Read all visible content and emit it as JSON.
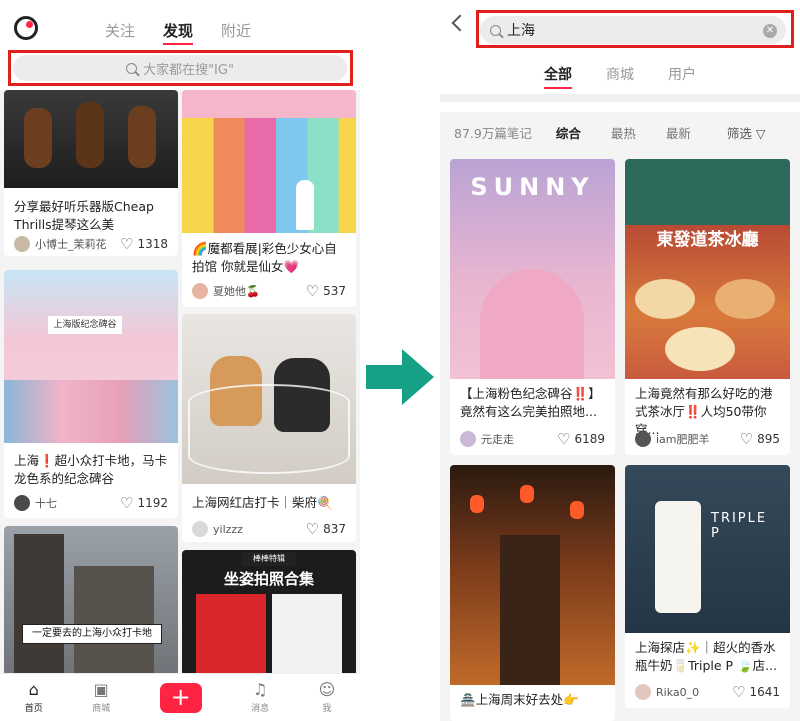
{
  "left": {
    "tabs": [
      "关注",
      "发现",
      "附近"
    ],
    "search_placeholder": "大家都在搜\"IG\"",
    "cards": [
      {
        "title": "分享最好听乐器版Cheap Thrills提琴这么美",
        "author": "小博士_茉莉花",
        "likes": "1318"
      },
      {
        "title": "🌈魔都看展|彩色少女心自拍馆 你就是仙女💗",
        "author": "夏她他🍒",
        "likes": "537"
      },
      {
        "title": "上海❗️超小众打卡地，马卡龙色系的纪念碑谷",
        "author": "十七",
        "likes": "1192",
        "overlay": "上海版纪念碑谷"
      },
      {
        "title": "上海网红店打卡｜柴府🍭",
        "author": "yilzzz",
        "likes": "837"
      },
      {
        "overlay": "一定要去的上海小众打卡地"
      },
      {
        "overlay_top": "棒棒特辑",
        "overlay": "坐姿拍照合集"
      }
    ],
    "nav": [
      "首页",
      "商城",
      "",
      "消息",
      "我"
    ]
  },
  "right": {
    "search_value": "上海",
    "cat_tabs": [
      "全部",
      "商城",
      "用户"
    ],
    "count": "87.9万篇笔记",
    "sorts": [
      "综合",
      "最热",
      "最新"
    ],
    "filter": "筛选",
    "cards": [
      {
        "title": "【上海粉色纪念碑谷‼️】竟然有这么完美拍照地...",
        "author": "元走走",
        "likes": "6189",
        "overlay": "SUNNY"
      },
      {
        "title": "上海竟然有那么好吃的港式茶冰厅‼️人均50带你穿...",
        "author": "iam肥肥羊",
        "likes": "895",
        "overlay": "東發道茶冰廳"
      },
      {
        "title": "🏯上海周末好去处👉",
        "author": "",
        "likes": ""
      },
      {
        "title": "上海探店✨｜超火的香水瓶牛奶🥛Triple P 🍃店...",
        "author": "Rika0_0",
        "likes": "1641"
      }
    ]
  },
  "colors": {
    "accent": "#ff2442",
    "highlight": "#e0201c",
    "arrow": "#16a085"
  }
}
